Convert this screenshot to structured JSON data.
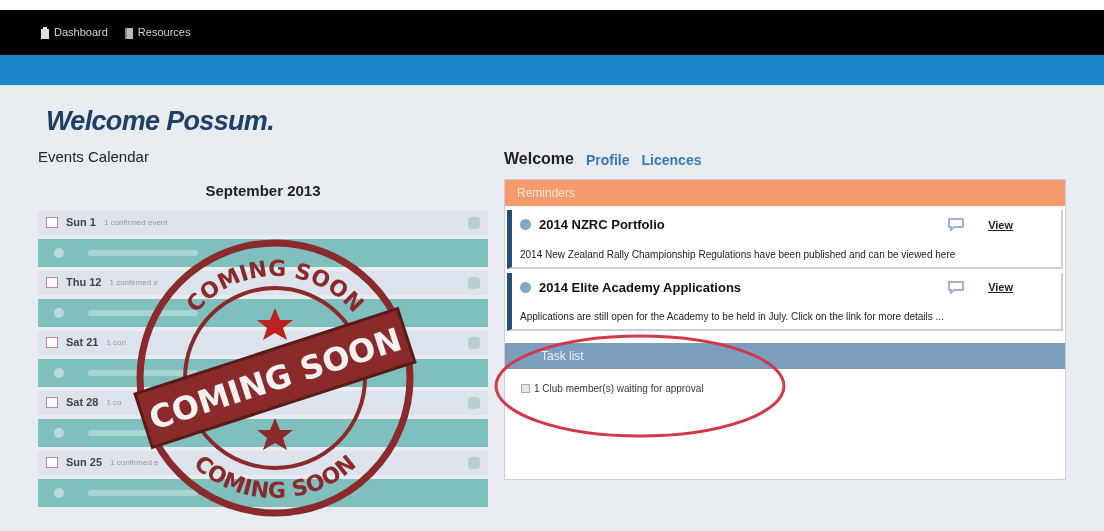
{
  "nav": {
    "items": [
      {
        "label": "Dashboard",
        "kind": "home"
      },
      {
        "label": "Resources",
        "kind": "book"
      }
    ]
  },
  "heading": "Welcome Possum.",
  "calendar": {
    "title": "Events Calendar",
    "month": "September 2013",
    "days": [
      {
        "label": "Sun 1",
        "note": "1 confirmed event"
      },
      {
        "label": "Thu 12",
        "note": "1 confirmed e"
      },
      {
        "label": "Sat 21",
        "note": "1 con"
      },
      {
        "label": "Sat 28",
        "note": "1 co"
      },
      {
        "label": "Sun 25",
        "note": "1 confirmed e"
      }
    ]
  },
  "stamp": {
    "top": "COMING SOON",
    "middle": "COMING SOON",
    "bottom": "COMING SOON"
  },
  "tabs": [
    {
      "label": "Welcome",
      "selected": true
    },
    {
      "label": "Profile",
      "selected": false
    },
    {
      "label": "Licences",
      "selected": false
    }
  ],
  "reminders": {
    "title": "Reminders",
    "items": [
      {
        "title": "2014 NZRC Portfolio",
        "link": "View",
        "text": "2014 New Zealand Rally Championship Regulations have been published and can be viewed here"
      },
      {
        "title": "2014 Elite Academy Applications",
        "link": "View",
        "text": "Applications are still open for the Academy to be held in July. Click on the link for more details ..."
      }
    ]
  },
  "tasks": {
    "title": "Task list",
    "items": [
      {
        "text": "1 Club member(s) waiting for approval",
        "checked": false
      }
    ]
  }
}
